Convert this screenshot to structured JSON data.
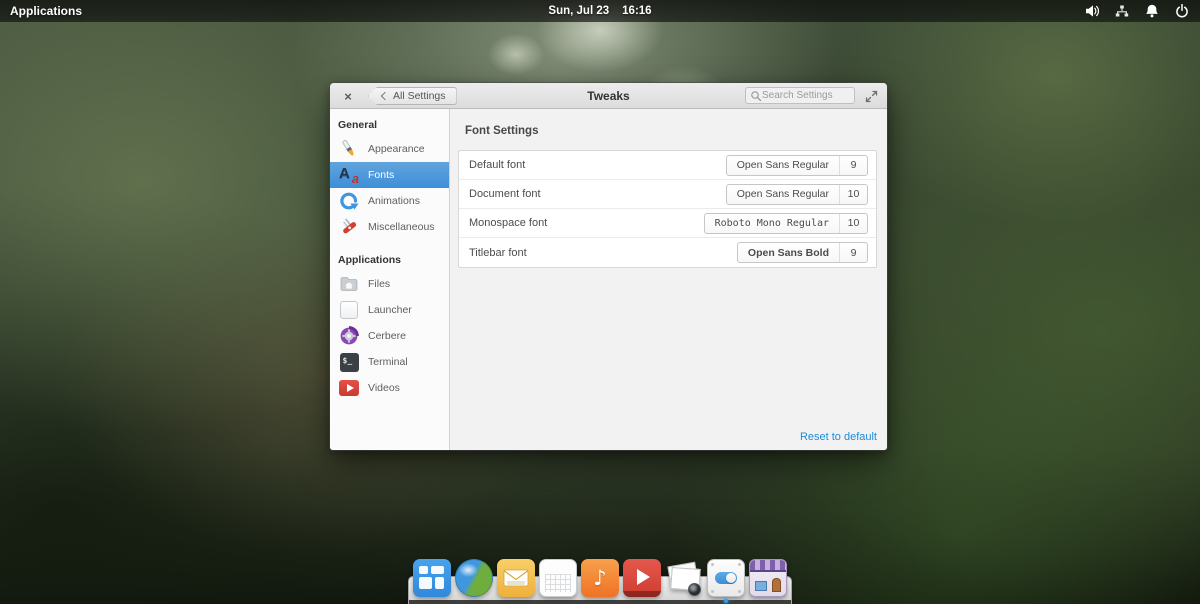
{
  "topbar": {
    "applications_label": "Applications",
    "clock_date": "Sun, Jul 23",
    "clock_time": "16:16",
    "tray_icons": [
      "volume-icon",
      "network-icon",
      "notifications-icon",
      "power-icon"
    ]
  },
  "window": {
    "title": "Tweaks",
    "close_glyph": "×",
    "back_button_label": "All Settings",
    "search_placeholder": "Search Settings",
    "sidebar": {
      "sections": [
        {
          "heading": "General",
          "items": [
            {
              "label": "Appearance",
              "icon": "appearance-icon",
              "selected": false
            },
            {
              "label": "Fonts",
              "icon": "fonts-icon",
              "selected": true
            },
            {
              "label": "Animations",
              "icon": "animations-icon",
              "selected": false
            },
            {
              "label": "Miscellaneous",
              "icon": "miscellaneous-icon",
              "selected": false
            }
          ]
        },
        {
          "heading": "Applications",
          "items": [
            {
              "label": "Files",
              "icon": "files-icon",
              "selected": false
            },
            {
              "label": "Launcher",
              "icon": "launcher-icon",
              "selected": false
            },
            {
              "label": "Cerbere",
              "icon": "cerbere-icon",
              "selected": false
            },
            {
              "label": "Terminal",
              "icon": "terminal-icon",
              "selected": false
            },
            {
              "label": "Videos",
              "icon": "videos-icon",
              "selected": false
            }
          ]
        }
      ]
    },
    "content": {
      "heading": "Font Settings",
      "rows": [
        {
          "label": "Default font",
          "font": "Open Sans Regular",
          "size": "9"
        },
        {
          "label": "Document font",
          "font": "Open Sans Regular",
          "size": "10"
        },
        {
          "label": "Monospace font",
          "font": "Roboto Mono Regular",
          "size": "10"
        },
        {
          "label": "Titlebar font",
          "font": "Open Sans Bold",
          "size": "9"
        }
      ],
      "reset_link": "Reset to default"
    }
  },
  "dock": {
    "items": [
      "multitasking",
      "web-browser",
      "mail",
      "calendar",
      "music",
      "videos",
      "photos",
      "system-settings",
      "appcenter"
    ],
    "active_item": "system-settings"
  },
  "icon_glyphs": {
    "fonts_big": "A",
    "fonts_small": "a",
    "terminal_prompt": "$_",
    "music_note": "♪"
  },
  "colors": {
    "selection_blue": "#3e8ed8",
    "link_blue": "#1f8bd6",
    "dock_indicator_blue": "#2f9bf0",
    "titlebar_grey": "#e4e4e4",
    "content_grey": "#f2f2f2"
  }
}
